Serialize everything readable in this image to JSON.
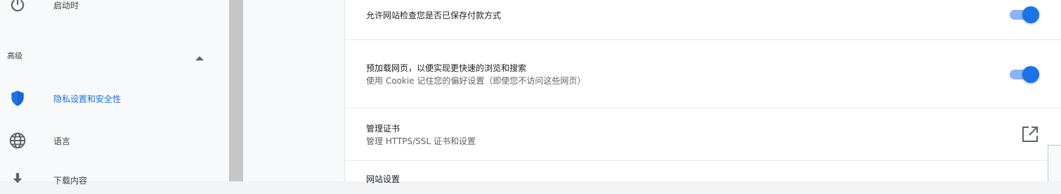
{
  "sidebar": {
    "items": [
      {
        "label": "启动时",
        "icon": "power-icon"
      },
      {
        "label": "隐私设置和安全性",
        "icon": "shield-icon"
      },
      {
        "label": "语言",
        "icon": "globe-icon"
      },
      {
        "label": "下载内容",
        "icon": "download-icon"
      }
    ],
    "advanced_label": "高级",
    "advanced_icon": "chevron-up-icon"
  },
  "settings": {
    "rows": [
      {
        "title": "允许网站检查您是否已保存付款方式",
        "control": "toggle",
        "enabled": true
      },
      {
        "title": "预加载网页，以便实现更快速的浏览和搜索",
        "subtitle": "使用 Cookie 记住您的偏好设置（即使您不访问这些网页）",
        "control": "toggle",
        "enabled": true
      },
      {
        "title": "管理证书",
        "subtitle": "管理 HTTPS/SSL 证书和设置",
        "control": "open-in-new-icon"
      },
      {
        "title": "网站设置"
      }
    ]
  },
  "colors": {
    "accent": "#1a73e8",
    "toggle_track": "#8ab4f8"
  }
}
